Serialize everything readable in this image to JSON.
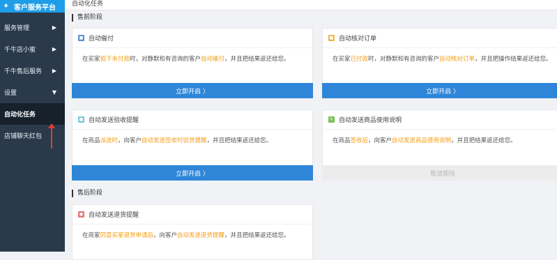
{
  "app": {
    "title": "客户服务平台"
  },
  "sidebar": {
    "items": [
      {
        "label": "服务管理",
        "chevron": "▶"
      },
      {
        "label": "千牛店小蜜",
        "chevron": "▶"
      },
      {
        "label": "千牛售后服务",
        "chevron": "▶"
      },
      {
        "label": "设置",
        "chevron": "▼"
      },
      {
        "label": "自动化任务",
        "chevron": ""
      },
      {
        "label": "店铺聊天红包",
        "chevron": ""
      }
    ]
  },
  "page": {
    "title": "自动化任务"
  },
  "sections": {
    "presale": "售前阶段",
    "aftersale": "售后阶段"
  },
  "cards": [
    {
      "title": "自动催付",
      "icon_color": "#5b8fd6",
      "desc": {
        "p1": "在买家",
        "h1": "拍下未付款",
        "p2": "时，对静默和有咨询的客户",
        "h2": "自动催付",
        "p3": "，并且把结果返还给您。"
      },
      "button": "立即开启 〉"
    },
    {
      "title": "自动核对订单",
      "icon_color": "#f0b44a",
      "desc": {
        "p1": "在买家",
        "h1": "已付款",
        "p2": "时，对静默和有咨询的客户",
        "h2": "自动核对订单",
        "p3": "，并且把操作结果返还给您。"
      },
      "button": "立即开启 〉"
    },
    {
      "title": "自动发送验收提醒",
      "icon_color": "#76c9d9",
      "desc": {
        "p1": "在商品",
        "h1": "派送时",
        "p2": "，向客户",
        "h2": "自动发送签收时验货提醒",
        "p3": "，并且把结果返还给您。"
      },
      "button": "立即开启 〉"
    },
    {
      "title": "自动发送商品使用说明",
      "icon_color": "#7ac25a",
      "desc": {
        "p1": "在商品",
        "h1": "签收后",
        "p2": "，向客户",
        "h2": "自动发送商品使用说明",
        "p3": "，并且把结果返还给您。"
      },
      "button": "敬请期待"
    },
    {
      "title": "自动发送退货提醒",
      "icon_color": "#e57a7a",
      "desc": {
        "p1": "在商家",
        "h1": "同意买家退货申请后",
        "p2": "，向客户",
        "h2": "自动发送退货提醒",
        "p3": "，并且把结果返还给您。"
      },
      "button": ""
    }
  ],
  "colors": {
    "sidebar_bg": "#2a3a4a",
    "accent": "#2f86d8",
    "highlight": "#f39c12",
    "arrow": "#e53935"
  }
}
